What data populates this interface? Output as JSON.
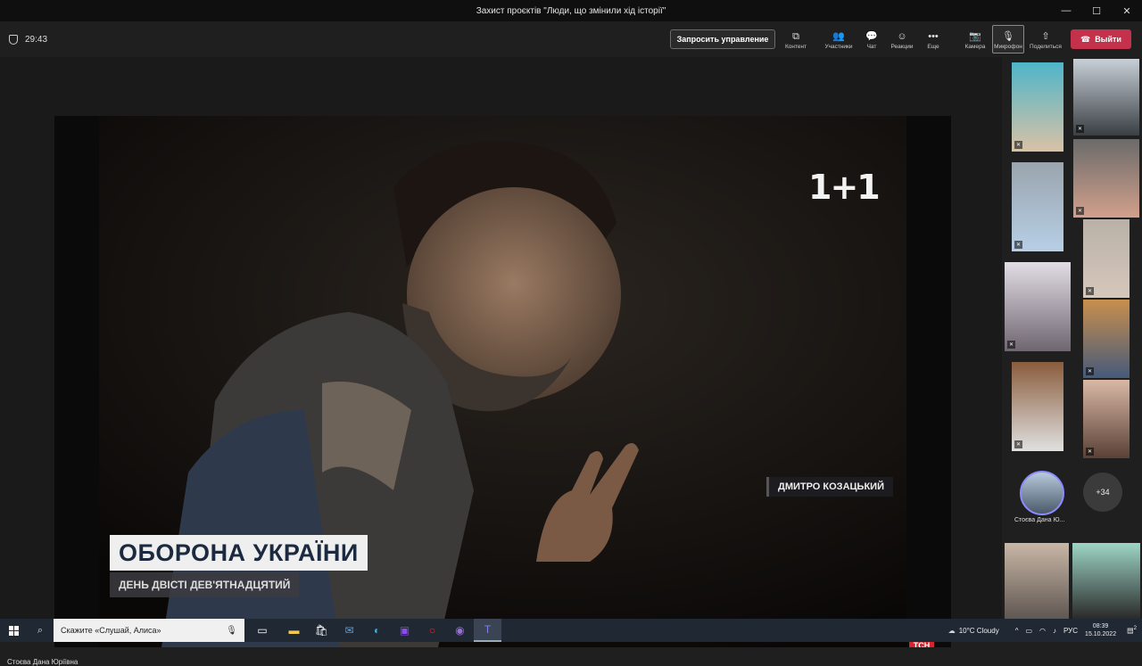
{
  "window": {
    "title": "Захист проєктів \"Люди, що змінили хід історії\"",
    "controls": [
      "—",
      "☐",
      "✕"
    ]
  },
  "call": {
    "timer": "29:43",
    "request_control": "Запросить управление",
    "tools": [
      {
        "icon": "⧉",
        "label": "Контент"
      },
      {
        "icon": "👥",
        "label": "Участники"
      },
      {
        "icon": "💬",
        "label": "Чат"
      },
      {
        "icon": "☺",
        "label": "Реакции"
      },
      {
        "icon": "•••",
        "label": "Еще"
      },
      {
        "icon": "📷",
        "label": "Камера"
      },
      {
        "icon": "🎙",
        "label": "Микрофон"
      },
      {
        "icon": "⇧",
        "label": "Поделиться"
      }
    ],
    "leave": "Выйти",
    "leave_color": "#c4314b"
  },
  "video": {
    "channel_logo": "1+1",
    "name_tag": "ДМИТРО КОЗАЦЬКИЙ",
    "headline": "ОБОРОНА УКРАЇНИ",
    "subline": "ДЕНЬ ДВІСТІ ДЕВ'ЯТНАДЦЯТИЙ",
    "corner_logo": "ТСН"
  },
  "presenter_name": "Стоєва Дана Юріївна",
  "gallery": {
    "avatar_name": "Стоєва Дана Ю...",
    "more_count": "+34"
  },
  "taskbar": {
    "search_placeholder": "Скажите «Слушай, Алиса»",
    "weather": "10°C  Cloudy",
    "language": "РУС",
    "time": "08:39",
    "date": "15.10.2022",
    "notifications": "2"
  }
}
